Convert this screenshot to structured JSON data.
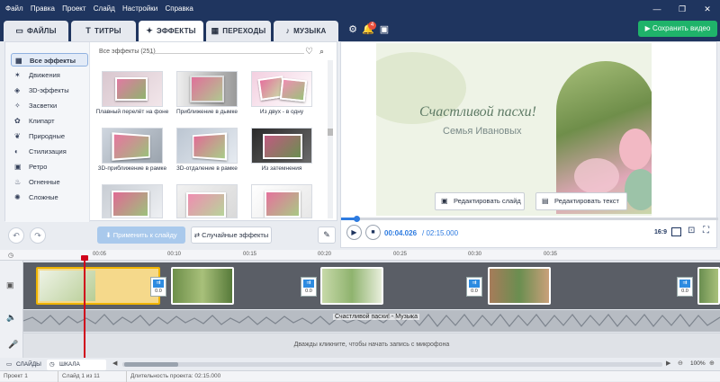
{
  "menu": [
    "Файл",
    "Правка",
    "Проект",
    "Слайд",
    "Настройки",
    "Справка"
  ],
  "window_controls": {
    "minimize": "—",
    "maximize": "❐",
    "close": "✕"
  },
  "tabs": [
    {
      "label": "ФАЙЛЫ",
      "icon": "folder-icon"
    },
    {
      "label": "ТИТРЫ",
      "icon": "text-icon"
    },
    {
      "label": "ЭФФЕКТЫ",
      "icon": "star-icon",
      "active": true
    },
    {
      "label": "ПЕРЕХОДЫ",
      "icon": "transition-icon"
    },
    {
      "label": "МУЗЫКА",
      "icon": "music-icon"
    }
  ],
  "notification_count": "4",
  "save_button": "Сохранить видео",
  "categories": [
    {
      "label": "Все эффекты",
      "icon": "grid-icon",
      "active": true
    },
    {
      "label": "Движения",
      "icon": "motion-icon"
    },
    {
      "label": "3D-эффекты",
      "icon": "cube-icon"
    },
    {
      "label": "Засветки",
      "icon": "sparkle-icon"
    },
    {
      "label": "Клипарт",
      "icon": "clipart-icon"
    },
    {
      "label": "Природные",
      "icon": "leaf-icon"
    },
    {
      "label": "Стилизация",
      "icon": "palette-icon"
    },
    {
      "label": "Ретро",
      "icon": "camera-icon"
    },
    {
      "label": "Огненные",
      "icon": "flame-icon"
    },
    {
      "label": "Сложные",
      "icon": "complex-icon"
    }
  ],
  "effects_header": "Все эффекты (251)",
  "effects": [
    {
      "label": "Плавный перелёт на фоне"
    },
    {
      "label": "Приближение в дымке"
    },
    {
      "label": "Из двух - в одну"
    },
    {
      "label": "3D-приближение в рамке"
    },
    {
      "label": "3D-отдаление в рамке"
    },
    {
      "label": "Из затемнения"
    },
    {
      "label": ""
    },
    {
      "label": ""
    },
    {
      "label": ""
    }
  ],
  "apply_button": "Применить к слайду",
  "random_button": "Случайные эффекты",
  "slide": {
    "title": "Счастливой пасхи!",
    "subtitle": "Семья Ивановых"
  },
  "edit_slide_button": "Редактировать слайд",
  "edit_text_button": "Редактировать текст",
  "time_current": "00:04.026",
  "time_total": "/ 02:15.000",
  "aspect": "16:9",
  "ruler_ticks": [
    "00:05",
    "00:10",
    "00:15",
    "00:20",
    "00:25",
    "00:30",
    "00:35"
  ],
  "transitions": [
    "0.0",
    "0.0",
    "0.0",
    "0.0"
  ],
  "audio_label": "Счастливой пасхи! - Музыка",
  "mic_label": "Дважды кликните, чтобы начать запись с микрофона",
  "bottom_tabs": {
    "slides": "СЛАЙДЫ",
    "timeline": "ШКАЛА ВРЕМЕНИ"
  },
  "zoom": "100%",
  "status": {
    "project": "Проект 1",
    "slide": "Слайд 1 из 11",
    "duration": "Длительность проекта: 02:15.000"
  },
  "colors": {
    "accent": "#2d7be0",
    "save": "#1fb36a",
    "titlebar": "#1f355f",
    "playhead": "#d0021b"
  }
}
